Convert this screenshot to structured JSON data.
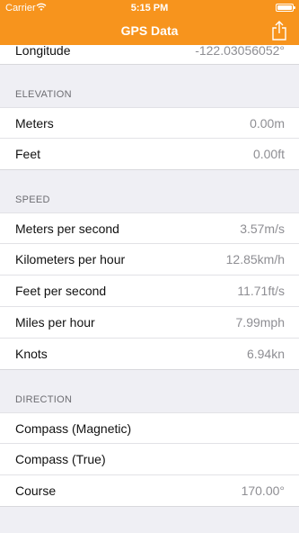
{
  "status_bar": {
    "carrier": "Carrier",
    "time": "5:15 PM"
  },
  "nav": {
    "title": "GPS Data"
  },
  "top_row": {
    "label": "Longitude",
    "value": "-122.03056052°"
  },
  "sections": [
    {
      "header": "ELEVATION",
      "rows": [
        {
          "label": "Meters",
          "value": "0.00m"
        },
        {
          "label": "Feet",
          "value": "0.00ft"
        }
      ]
    },
    {
      "header": "SPEED",
      "rows": [
        {
          "label": "Meters per second",
          "value": "3.57m/s"
        },
        {
          "label": "Kilometers per hour",
          "value": "12.85km/h"
        },
        {
          "label": "Feet per second",
          "value": "11.71ft/s"
        },
        {
          "label": "Miles per hour",
          "value": "7.99mph"
        },
        {
          "label": "Knots",
          "value": "6.94kn"
        }
      ]
    },
    {
      "header": "DIRECTION",
      "rows": [
        {
          "label": "Compass (Magnetic)",
          "value": ""
        },
        {
          "label": "Compass (True)",
          "value": ""
        },
        {
          "label": "Course",
          "value": "170.00°"
        }
      ]
    }
  ],
  "icons": {
    "wifi": "wifi-icon",
    "battery": "battery-icon",
    "share": "share-icon"
  },
  "colors": {
    "accent": "#f7941d"
  }
}
